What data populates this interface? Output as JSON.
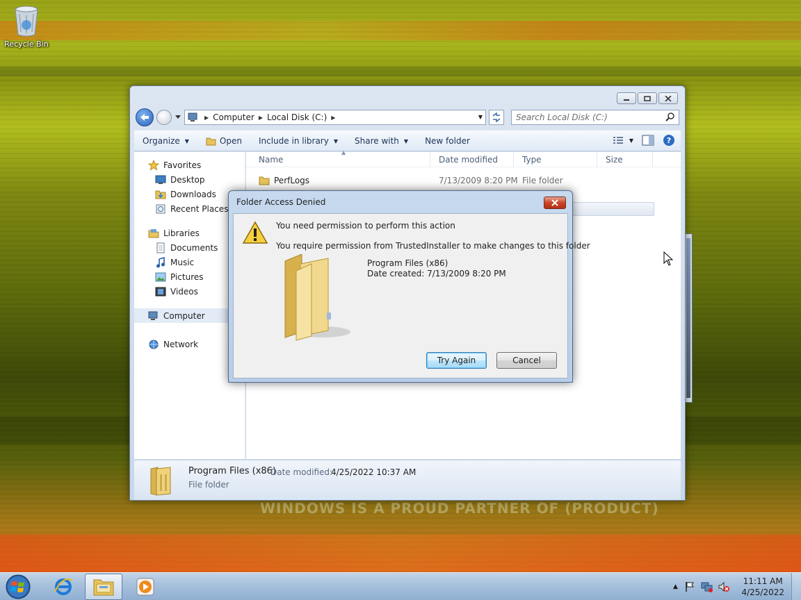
{
  "desktop": {
    "recycle_bin_label": "Recycle Bin",
    "wallpaper_text": "WINDOWS IS A PROUD PARTNER OF (PRODUCT)"
  },
  "explorer": {
    "breadcrumb": [
      "Computer",
      "Local Disk (C:)"
    ],
    "search_placeholder": "Search Local Disk (C:)",
    "toolbar": {
      "organize": "Organize",
      "open": "Open",
      "include_in_library": "Include in library",
      "share_with": "Share with",
      "new_folder": "New folder"
    },
    "nav": {
      "favorites": "Favorites",
      "favorites_items": [
        "Desktop",
        "Downloads",
        "Recent Places"
      ],
      "libraries": "Libraries",
      "libraries_items": [
        "Documents",
        "Music",
        "Pictures",
        "Videos"
      ],
      "computer": "Computer",
      "network": "Network"
    },
    "columns": {
      "name": "Name",
      "date_modified": "Date modified",
      "type": "Type",
      "size": "Size"
    },
    "files": [
      {
        "name": "PerfLogs",
        "date": "7/13/2009 8:20 PM",
        "type": "File folder"
      }
    ],
    "details": {
      "name": "Program Files (x86)",
      "date_label": "Date modified:",
      "date_value": "4/25/2022 10:37 AM",
      "type": "File folder"
    }
  },
  "dialog": {
    "title": "Folder Access Denied",
    "message_main": "You need permission to perform this action",
    "message_detail": "You require permission from TrustedInstaller to make changes to this folder",
    "folder_name": "Program Files (x86)",
    "folder_created": "Date created: 7/13/2009 8:20 PM",
    "try_again_label": "Try Again",
    "cancel_label": "Cancel"
  },
  "taskbar": {
    "time": "11:11 AM",
    "date": "4/25/2022"
  },
  "icons": {
    "back": "back-arrow-icon",
    "forward": "forward-arrow-icon",
    "search": "search-icon",
    "warning": "warning-icon",
    "folder": "folder-icon"
  }
}
